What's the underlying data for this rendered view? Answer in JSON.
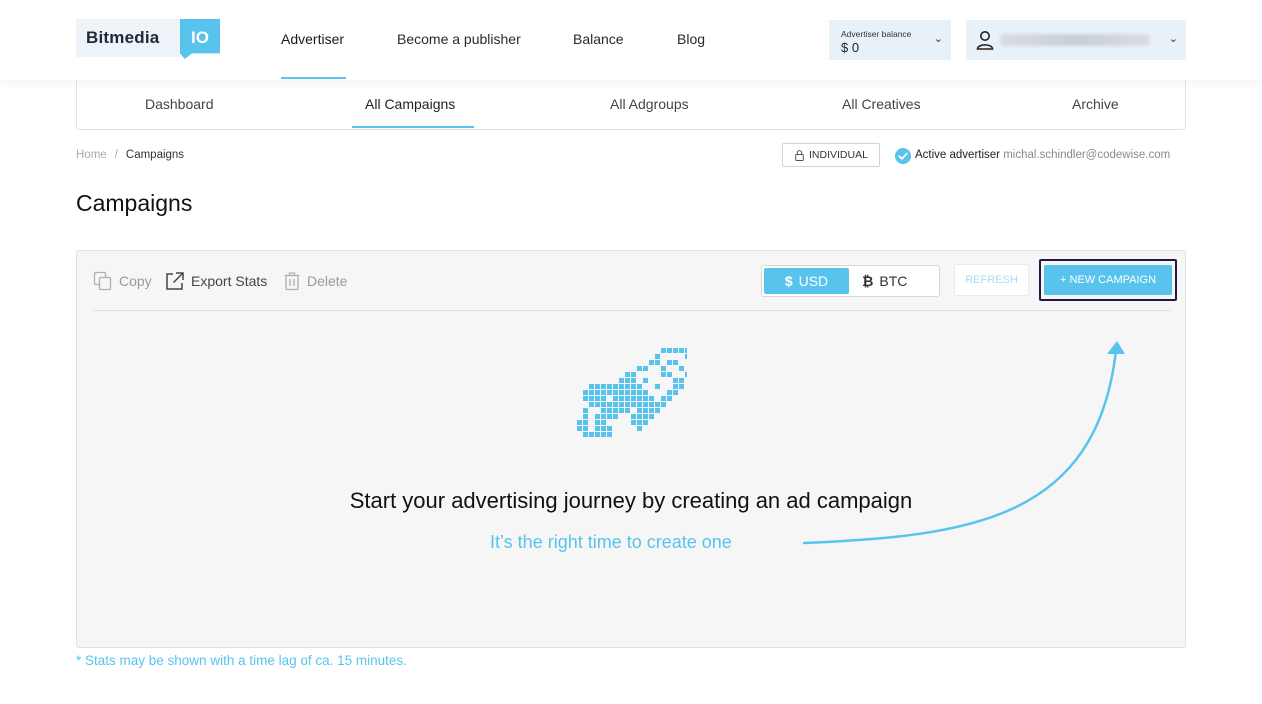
{
  "header": {
    "logo_text": "Bitmedia",
    "logo_badge": "IO",
    "nav": [
      "Advertiser",
      "Become a publisher",
      "Balance",
      "Blog"
    ],
    "balance_label": "Advertiser balance",
    "balance_value": "$ 0",
    "user_name": "",
    "chevron": "⌄"
  },
  "subnav": [
    "Dashboard",
    "All Campaigns",
    "All Adgroups",
    "All Creatives",
    "Archive"
  ],
  "breadcrumb": {
    "home": "Home",
    "sep": "/",
    "current": "Campaigns"
  },
  "account": {
    "type": "INDIVIDUAL",
    "active_label": "Active advertiser",
    "email": "michal.schindler@codewise.com"
  },
  "page_title": "Campaigns",
  "toolbar": {
    "copy": "Copy",
    "export": "Export Stats",
    "delete": "Delete",
    "usd": "USD",
    "btc": "BTC",
    "refresh": "REFRESH",
    "new_campaign": "+ NEW CAMPAIGN"
  },
  "empty_state": {
    "title": "Start your advertising journey by creating an ad campaign",
    "subtitle": "It’s the right time to create one",
    "icon": "rocket-icon"
  },
  "footnote": "* Stats may be shown with a time lag of ca. 15 minutes.",
  "colors": {
    "accent": "#58c4ee",
    "frame": "#1c1a4b"
  }
}
